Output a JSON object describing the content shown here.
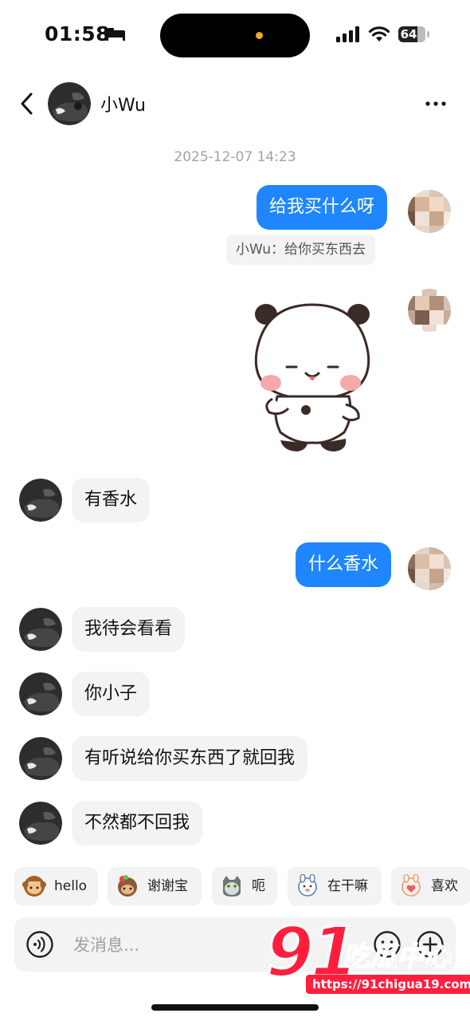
{
  "status_bar": {
    "time": "01:58",
    "battery": "64"
  },
  "header": {
    "contact_name": "小Wu"
  },
  "conversation": {
    "timestamp": "2025-12-07 14:23",
    "messages": [
      {
        "from": "me",
        "text": "给我买什么呀"
      },
      {
        "from": "me",
        "type": "quote",
        "text": "小Wu：给你买东西去"
      },
      {
        "from": "me",
        "type": "sticker"
      },
      {
        "from": "them",
        "text": "有香水"
      },
      {
        "from": "me",
        "text": "什么香水"
      },
      {
        "from": "them",
        "text": "我待会看看"
      },
      {
        "from": "them",
        "text": "你小子"
      },
      {
        "from": "them",
        "text": "有听说给你买东西了就回我"
      },
      {
        "from": "them",
        "text": "不然都不回我"
      }
    ]
  },
  "quick_replies": [
    {
      "label": "hello",
      "icon": "monkey-emoji-icon"
    },
    {
      "label": "谢谢宝",
      "icon": "monkey-flower-emoji-icon"
    },
    {
      "label": "呃",
      "icon": "cat-emoji-icon"
    },
    {
      "label": "在干嘛",
      "icon": "bunny-emoji-icon"
    },
    {
      "label": "喜欢",
      "icon": "bunny-heart-emoji-icon"
    }
  ],
  "input": {
    "placeholder": "发消息..."
  },
  "watermark": {
    "number": "91",
    "text": "吃瓜中心",
    "url": "https://91chigua19.com"
  },
  "colors": {
    "my_bubble": "#1f86ff",
    "their_bubble": "#f3f3f3",
    "watermark": "#ff1f3d"
  }
}
